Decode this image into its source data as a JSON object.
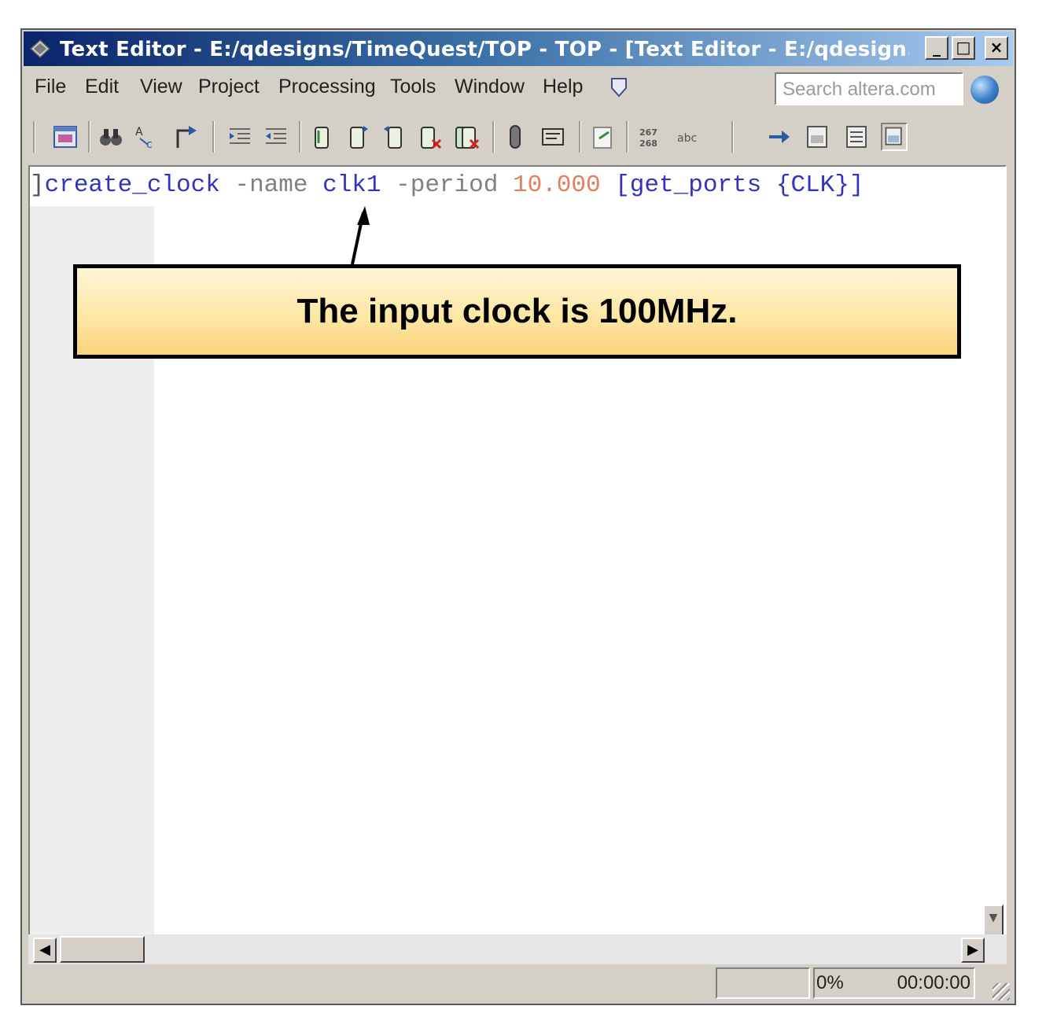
{
  "window": {
    "title": "Text Editor - E:/qdesigns/TimeQuest/TOP - TOP - [Text Editor - E:/qdesign...",
    "controls": [
      "_",
      "□",
      "×"
    ]
  },
  "menu": {
    "items": [
      "File",
      "Edit",
      "View",
      "Project",
      "Processing",
      "Tools",
      "Window",
      "Help"
    ],
    "search_placeholder": "Search altera.com"
  },
  "editor": {
    "code": {
      "command": "create_clock",
      "name_flag": "-name",
      "clock_name": "clk1",
      "period_flag": "-period",
      "period_value": "10.000",
      "ports": "[get_ports {CLK}]"
    }
  },
  "statusbar": {
    "progress": "0%",
    "time": "00:00:00"
  },
  "callout": {
    "text": "The input clock is 100MHz."
  },
  "colors": {
    "keyword": "#3333bb",
    "flag": "#808080",
    "number": "#e08060",
    "callout_top": "#fff5d6",
    "callout_bottom": "#fbd37a"
  }
}
